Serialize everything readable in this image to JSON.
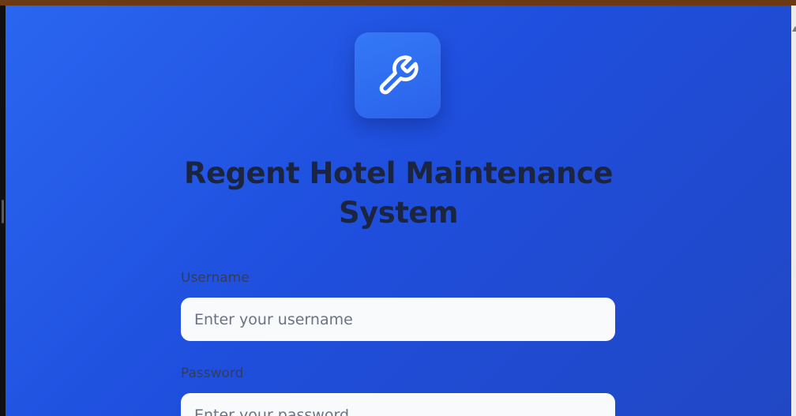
{
  "app": {
    "title": "Regent Hotel Maintenance System",
    "logo_icon": "wrench-icon"
  },
  "login_form": {
    "username_label": "Username",
    "username_placeholder": "Enter your username",
    "username_value": "",
    "password_label": "Password",
    "password_placeholder": "Enter your password",
    "password_value": ""
  },
  "colors": {
    "background_gradient_start": "#2a66f0",
    "background_gradient_end": "#2147c4",
    "logo_tile": "#2f6ef2",
    "title_text": "#1b2540",
    "label_text": "#333d5a",
    "input_background": "#f8fafc",
    "top_strip": "#6b3a14"
  }
}
